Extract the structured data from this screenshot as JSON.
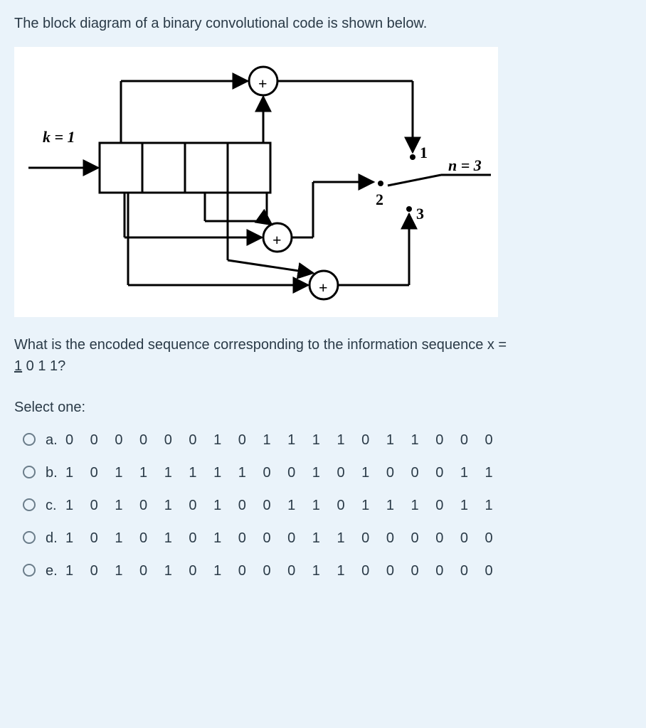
{
  "prompt": "The block diagram of a binary convolutional code is shown below.",
  "diagram": {
    "k_label": "k = 1",
    "n_label": "n = 3",
    "out1": "1",
    "out2": "2",
    "out3": "3",
    "adder": "+"
  },
  "question_prefix": "What is the encoded sequence corresponding to the information sequence x =",
  "info_seq_first": "1",
  "info_seq_rest": "   0    1    1?",
  "select_one": "Select one:",
  "options": [
    {
      "letter": "a.",
      "sequence": "0 0 0 0 0 0 1 0 1 1 1 1 0 1 1 0 0 0"
    },
    {
      "letter": "b.",
      "sequence": "1 0 1 1 1 1 1 1 0 0 1 0 1 0 0 0 1 1"
    },
    {
      "letter": "c.",
      "sequence": "1 0 1 0 1 0 1 0 0 1 1 0 1 1 1 0 1 1"
    },
    {
      "letter": "d.",
      "sequence": "1 0 1 0 1 0 1 0 0 0 1 1 0 0 0 0 0 0"
    },
    {
      "letter": "e.",
      "sequence": "1 0 1 0 1 0 1 0 0 0 1 1 0 0 0 0 0 0"
    }
  ]
}
